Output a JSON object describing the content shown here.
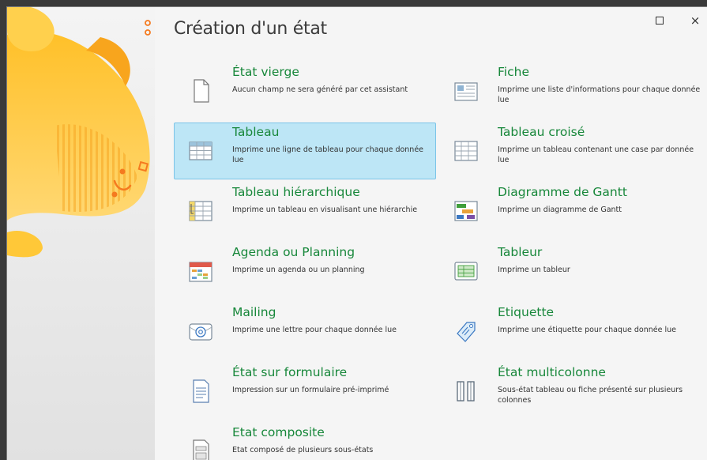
{
  "window": {
    "title": "Création d'un état",
    "maximize_icon": "square-icon",
    "close_label": "×"
  },
  "options": [
    {
      "id": "etat-vierge",
      "label": "État vierge",
      "desc": "Aucun champ ne sera généré par cet assistant",
      "icon": "blank-page-icon",
      "selected": false
    },
    {
      "id": "fiche",
      "label": "Fiche",
      "desc": "Imprime une liste d'informations pour chaque donnée lue",
      "icon": "form-card-icon",
      "selected": false
    },
    {
      "id": "tableau",
      "label": "Tableau",
      "desc": "Imprime une ligne de tableau pour chaque donnée lue",
      "icon": "table-icon",
      "selected": true
    },
    {
      "id": "tableau-croise",
      "label": "Tableau croisé",
      "desc": "Imprime un tableau contenant une case par donnée lue",
      "icon": "crosstab-icon",
      "selected": false
    },
    {
      "id": "tableau-hierarchique",
      "label": "Tableau hiérarchique",
      "desc": "Imprime un tableau en visualisant une hiérarchie",
      "icon": "tree-table-icon",
      "selected": false
    },
    {
      "id": "gantt",
      "label": "Diagramme de Gantt",
      "desc": "Imprime un diagramme de Gantt",
      "icon": "gantt-icon",
      "selected": false
    },
    {
      "id": "agenda",
      "label": "Agenda ou Planning",
      "desc": "Imprime un agenda ou un planning",
      "icon": "calendar-icon",
      "selected": false
    },
    {
      "id": "tableur",
      "label": "Tableur",
      "desc": "Imprime un tableur",
      "icon": "spreadsheet-icon",
      "selected": false
    },
    {
      "id": "mailing",
      "label": "Mailing",
      "desc": "Imprime une lettre pour chaque donnée lue",
      "icon": "at-mail-icon",
      "selected": false
    },
    {
      "id": "etiquette",
      "label": "Etiquette",
      "desc": "Imprime une étiquette pour chaque donnée lue",
      "icon": "label-tag-icon",
      "selected": false
    },
    {
      "id": "etat-formulaire",
      "label": "État sur formulaire",
      "desc": "Impression sur un formulaire pré-imprimé",
      "icon": "preprinted-form-icon",
      "selected": false
    },
    {
      "id": "etat-multicolonne",
      "label": "État multicolonne",
      "desc": "Sous-état tableau ou fiche présenté sur plusieurs colonnes",
      "icon": "columns-icon",
      "selected": false
    },
    {
      "id": "etat-composite",
      "label": "Etat composite",
      "desc": "Etat composé de plusieurs sous-états",
      "icon": "composite-doc-icon",
      "selected": false
    }
  ],
  "colors": {
    "label_green": "#17873a",
    "selected_bg": "#bde6f6",
    "selected_border": "#7bc4e8",
    "side_yellow": "#ffc53a",
    "side_orange": "#f57a1f"
  }
}
